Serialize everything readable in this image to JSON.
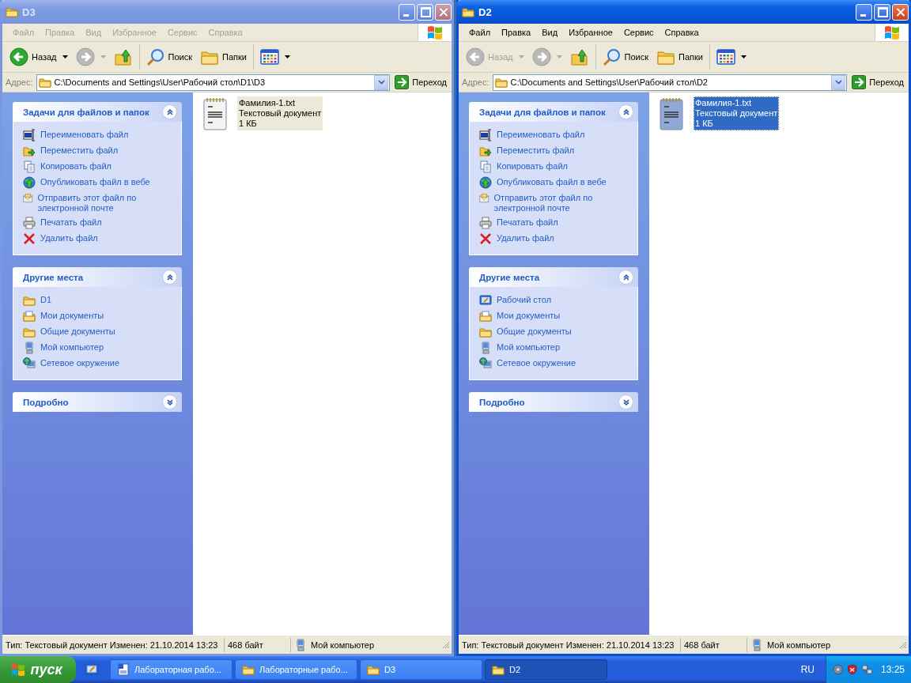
{
  "windows": [
    {
      "title": "D3",
      "active": false,
      "menu": [
        "Файл",
        "Правка",
        "Вид",
        "Избранное",
        "Сервис",
        "Справка"
      ],
      "toolbar": [
        {
          "kind": "back",
          "label": "Назад",
          "disabled": false
        },
        {
          "kind": "forward",
          "disabled": true
        },
        {
          "kind": "up"
        },
        {
          "kind": "search",
          "label": "Поиск"
        },
        {
          "kind": "folders",
          "label": "Папки"
        },
        {
          "kind": "views"
        }
      ],
      "address_label": "Адрес:",
      "address": "C:\\Documents and Settings\\User\\Рабочий стол\\D1\\D3",
      "go": "Переход",
      "panels": [
        {
          "title": "Задачи для файлов и папок",
          "expanded": true,
          "items": [
            {
              "kind": "rename",
              "label": "Переименовать файл"
            },
            {
              "kind": "move",
              "label": "Переместить файл"
            },
            {
              "kind": "copy",
              "label": "Копировать файл"
            },
            {
              "kind": "publish",
              "label": "Опубликовать файл в вебе"
            },
            {
              "kind": "email",
              "label": "Отправить этот файл по электронной почте"
            },
            {
              "kind": "print",
              "label": "Печатать файл"
            },
            {
              "kind": "delete",
              "label": "Удалить файл"
            }
          ]
        },
        {
          "title": "Другие места",
          "expanded": true,
          "items": [
            {
              "kind": "folder",
              "label": "D1"
            },
            {
              "kind": "documents",
              "label": "Мои документы"
            },
            {
              "kind": "folder",
              "label": "Общие документы"
            },
            {
              "kind": "computer",
              "label": "Мой компьютер"
            },
            {
              "kind": "network",
              "label": "Сетевое окружение"
            }
          ]
        },
        {
          "title": "Подробно",
          "expanded": false
        }
      ],
      "files": [
        {
          "name": "Фамилия-1.txt",
          "type": "Текстовый документ",
          "size": "1 КБ",
          "selected": true
        }
      ],
      "status": {
        "info": "Тип: Текстовый документ Изменен: 21.10.2014 13:23",
        "size": "468 байт",
        "zone": "Мой компьютер"
      }
    },
    {
      "title": "D2",
      "active": true,
      "menu": [
        "Файл",
        "Правка",
        "Вид",
        "Избранное",
        "Сервис",
        "Справка"
      ],
      "toolbar": [
        {
          "kind": "back",
          "label": "Назад",
          "disabled": true
        },
        {
          "kind": "forward",
          "disabled": true
        },
        {
          "kind": "up"
        },
        {
          "kind": "search",
          "label": "Поиск"
        },
        {
          "kind": "folders",
          "label": "Папки"
        },
        {
          "kind": "views"
        }
      ],
      "address_label": "Адрес:",
      "address": "C:\\Documents and Settings\\User\\Рабочий стол\\D2",
      "go": "Переход",
      "panels": [
        {
          "title": "Задачи для файлов и папок",
          "expanded": true,
          "items": [
            {
              "kind": "rename",
              "label": "Переименовать файл"
            },
            {
              "kind": "move",
              "label": "Переместить файл"
            },
            {
              "kind": "copy",
              "label": "Копировать файл"
            },
            {
              "kind": "publish",
              "label": "Опубликовать файл в вебе"
            },
            {
              "kind": "email",
              "label": "Отправить этот файл по электронной почте"
            },
            {
              "kind": "print",
              "label": "Печатать файл"
            },
            {
              "kind": "delete",
              "label": "Удалить файл"
            }
          ]
        },
        {
          "title": "Другие места",
          "expanded": true,
          "items": [
            {
              "kind": "desktop",
              "label": "Рабочий стол"
            },
            {
              "kind": "documents",
              "label": "Мои документы"
            },
            {
              "kind": "folder",
              "label": "Общие документы"
            },
            {
              "kind": "computer",
              "label": "Мой компьютер"
            },
            {
              "kind": "network",
              "label": "Сетевое окружение"
            }
          ]
        },
        {
          "title": "Подробно",
          "expanded": false
        }
      ],
      "files": [
        {
          "name": "Фамилия-1.txt",
          "type": "Текстовый документ",
          "size": "1 КБ",
          "selected": true
        }
      ],
      "status": {
        "info": "Тип: Текстовый документ Изменен: 21.10.2014 13:23",
        "size": "468 байт",
        "zone": "Мой компьютер"
      }
    }
  ],
  "taskbar": {
    "start": "пуск",
    "tasks": [
      {
        "kind": "document",
        "label": "Лабораторная рабо...",
        "selected": false
      },
      {
        "kind": "folder",
        "label": "Лабораторные рабо...",
        "selected": false
      },
      {
        "kind": "folder",
        "label": "D3",
        "selected": false
      },
      {
        "kind": "folder",
        "label": "D2",
        "selected": true
      }
    ],
    "language": "RU",
    "clock": "13:25"
  }
}
